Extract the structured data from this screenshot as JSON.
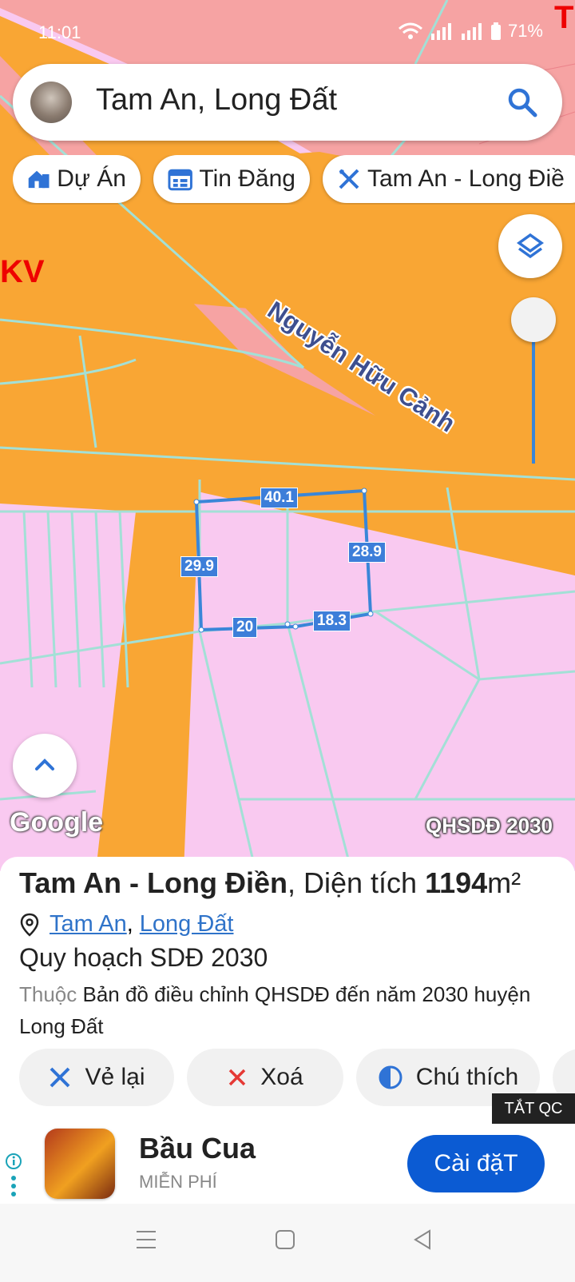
{
  "status": {
    "time": "11:01",
    "battery": "71%"
  },
  "search": {
    "query": "Tam An, Long Đất"
  },
  "chips": [
    {
      "label": "Dự Án"
    },
    {
      "label": "Tin Đăng"
    },
    {
      "label": "Tam An - Long Điề"
    }
  ],
  "map": {
    "road_label": "Nguyễn Hữu Cảnh",
    "zone_label": "KV",
    "edge_label": "T",
    "google_label": "Google",
    "layer_label": "QHSDĐ 2030",
    "dimensions": {
      "top": "40.1",
      "left": "29.9",
      "right": "28.9",
      "bottom_left": "20",
      "bottom_right": "18.3"
    }
  },
  "sheet": {
    "title_name": "Tam An - Long Điền",
    "title_mid": ", Diện tích ",
    "area": "1194",
    "area_unit": "m²",
    "loc1": "Tam An",
    "loc_sep": ",",
    "loc2": "Long Đất",
    "plan": "Quy hoạch SDĐ 2030",
    "desc_prefix": "Thuộc",
    "desc": " Bản đồ điều chỉnh QHSDĐ đến năm 2030 huyện Long Đất"
  },
  "actions": [
    {
      "label": "Vẻ lại"
    },
    {
      "label": "Xoá"
    },
    {
      "label": "Chú thích"
    }
  ],
  "ad": {
    "close_label": "TẮT QC",
    "app_name": "Bầu Cua",
    "app_sub": "MIỄN PHÍ",
    "install_label": "Cài đặT"
  },
  "colors": {
    "accent": "#3a86d8",
    "map_orange": "#f9a634",
    "map_pink": "#f9c9f0",
    "map_red": "#f6a3a3",
    "install_blue": "#0b5bd3"
  }
}
